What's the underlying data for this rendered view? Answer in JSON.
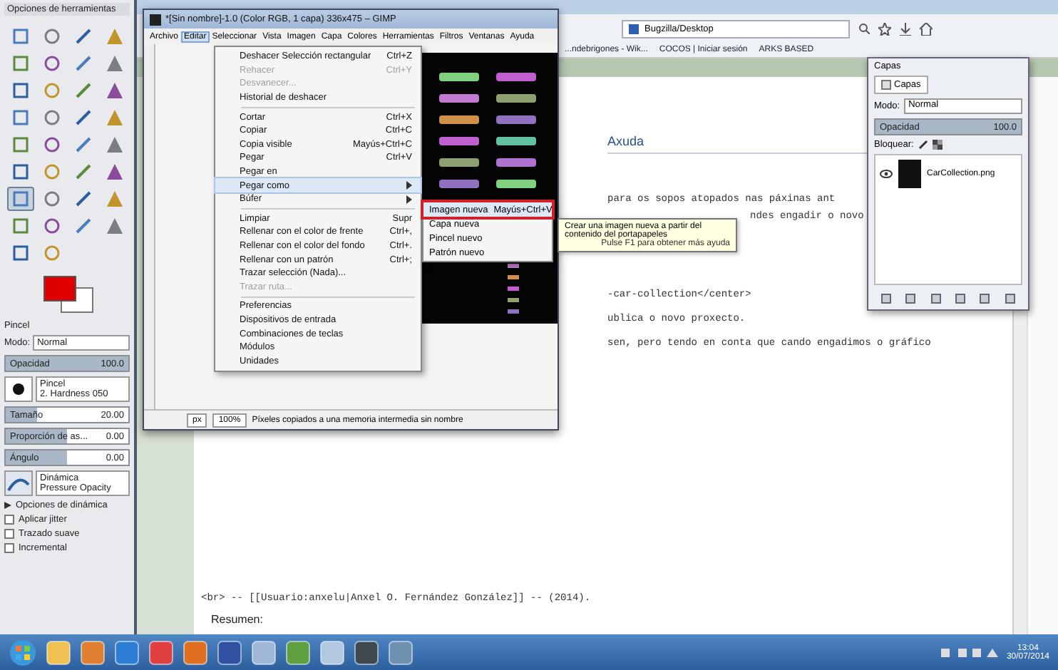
{
  "toolbox": {
    "title": "Opciones de herramientas",
    "tools": [
      {
        "selected": false
      },
      {
        "selected": false
      },
      {
        "selected": false
      },
      {
        "selected": false
      },
      {
        "selected": false
      },
      {
        "selected": false
      },
      {
        "selected": false
      },
      {
        "selected": false
      },
      {
        "selected": false
      },
      {
        "selected": false
      },
      {
        "selected": false
      },
      {
        "selected": false
      },
      {
        "selected": false
      },
      {
        "selected": false
      },
      {
        "selected": false
      },
      {
        "selected": false
      },
      {
        "selected": false
      },
      {
        "selected": false
      },
      {
        "selected": false
      },
      {
        "selected": false
      },
      {
        "selected": false
      },
      {
        "selected": false
      },
      {
        "selected": false
      },
      {
        "selected": false
      },
      {
        "selected": true
      },
      {
        "selected": false
      },
      {
        "selected": false
      },
      {
        "selected": false
      },
      {
        "selected": false
      },
      {
        "selected": false
      },
      {
        "selected": false
      },
      {
        "selected": false
      },
      {
        "selected": false
      },
      {
        "selected": false
      }
    ],
    "tool_name": "Pincel",
    "mode_label": "Modo:",
    "mode_value": "Normal",
    "sliders": [
      {
        "label": "Opacidad",
        "value": "100.0",
        "level": 1
      },
      {
        "label": "Tamaño",
        "value": "20.00",
        "level": 0.25
      },
      {
        "label": "Proporción de as...",
        "value": "0.00",
        "level": 0.5
      },
      {
        "label": "Ángulo",
        "value": "0.00",
        "level": 0.5
      }
    ],
    "brush": {
      "label": "Pincel",
      "value": "2. Hardness 050"
    },
    "dynamics": {
      "label": "Dinámica",
      "value": "Pressure Opacity"
    },
    "expander": {
      "label": "Opciones de dinámica",
      "expanded": false
    },
    "checks": [
      {
        "label": "Aplicar jitter",
        "checked": false
      },
      {
        "label": "Trazado suave",
        "checked": false
      },
      {
        "label": "Incremental",
        "checked": false
      }
    ]
  },
  "gimp": {
    "title": "*[Sin nombre]-1.0 (Color RGB, 1 capa) 336x475 – GIMP",
    "menus": [
      {
        "label": "Archivo",
        "selected": false
      },
      {
        "label": "Editar",
        "selected": true
      },
      {
        "label": "Seleccionar",
        "selected": false
      },
      {
        "label": "Vista",
        "selected": false
      },
      {
        "label": "Imagen",
        "selected": false
      },
      {
        "label": "Capa",
        "selected": false
      },
      {
        "label": "Colores",
        "selected": false
      },
      {
        "label": "Herramientas",
        "selected": false
      },
      {
        "label": "Filtros",
        "selected": false
      },
      {
        "label": "Ventanas",
        "selected": false
      },
      {
        "label": "Ayuda",
        "selected": false
      }
    ],
    "status": {
      "unit": "px",
      "zoom": "100%",
      "message": "Píxeles copiados a una memoria intermedia sin nombre"
    }
  },
  "edit_menu": [
    {
      "kind": "item",
      "label": "Deshacer Selección rectangular",
      "shortcut": "Ctrl+Z",
      "disabled": false,
      "submenu": false,
      "selected": false
    },
    {
      "kind": "item",
      "label": "Rehacer",
      "shortcut": "Ctrl+Y",
      "disabled": true,
      "submenu": false,
      "selected": false
    },
    {
      "kind": "item",
      "label": "Desvanecer...",
      "disabled": true,
      "submenu": false,
      "selected": false
    },
    {
      "kind": "item",
      "label": "Historial de deshacer",
      "disabled": false,
      "submenu": false,
      "selected": false
    },
    {
      "kind": "separator"
    },
    {
      "kind": "item",
      "label": "Cortar",
      "shortcut": "Ctrl+X",
      "disabled": false,
      "submenu": false,
      "selected": false
    },
    {
      "kind": "item",
      "label": "Copiar",
      "shortcut": "Ctrl+C",
      "disabled": false,
      "submenu": false,
      "selected": false
    },
    {
      "kind": "item",
      "label": "Copia visible",
      "shortcut": "Mayús+Ctrl+C",
      "disabled": false,
      "submenu": false,
      "selected": false
    },
    {
      "kind": "item",
      "label": "Pegar",
      "shortcut": "Ctrl+V",
      "disabled": false,
      "submenu": false,
      "selected": false
    },
    {
      "kind": "item",
      "label": "Pegar en",
      "disabled": false,
      "submenu": false,
      "selected": false
    },
    {
      "kind": "item",
      "label": "Pegar como",
      "disabled": false,
      "submenu": true,
      "selected": true
    },
    {
      "kind": "item",
      "label": "Búfer",
      "disabled": false,
      "submenu": true,
      "selected": false
    },
    {
      "kind": "separator"
    },
    {
      "kind": "item",
      "label": "Limpiar",
      "shortcut": "Supr",
      "disabled": false,
      "submenu": false,
      "selected": false
    },
    {
      "kind": "item",
      "label": "Rellenar con el color de frente",
      "shortcut": "Ctrl+,",
      "disabled": false,
      "submenu": false,
      "selected": false
    },
    {
      "kind": "item",
      "label": "Rellenar con el color del fondo",
      "shortcut": "Ctrl+.",
      "disabled": false,
      "submenu": false,
      "selected": false
    },
    {
      "kind": "item",
      "label": "Rellenar con un patrón",
      "shortcut": "Ctrl+;",
      "disabled": false,
      "submenu": false,
      "selected": false
    },
    {
      "kind": "item",
      "label": "Trazar selección (Nada)...",
      "disabled": false,
      "submenu": false,
      "selected": false
    },
    {
      "kind": "item",
      "label": "Trazar ruta...",
      "disabled": true,
      "submenu": false,
      "selected": false
    },
    {
      "kind": "separator"
    },
    {
      "kind": "item",
      "label": "Preferencias",
      "disabled": false,
      "submenu": false,
      "selected": false
    },
    {
      "kind": "item",
      "label": "Dispositivos de entrada",
      "disabled": false,
      "submenu": false,
      "selected": false
    },
    {
      "kind": "item",
      "label": "Combinaciones de teclas",
      "disabled": false,
      "submenu": false,
      "selected": false
    },
    {
      "kind": "item",
      "label": "Módulos",
      "disabled": false,
      "submenu": false,
      "selected": false
    },
    {
      "kind": "item",
      "label": "Unidades",
      "disabled": false,
      "submenu": false,
      "selected": false
    }
  ],
  "paste_as_menu": [
    {
      "label": "Imagen nueva",
      "shortcut": "Mayús+Ctrl+V",
      "selected": true
    },
    {
      "label": "Capa nueva",
      "selected": false
    },
    {
      "label": "Pincel nuevo",
      "selected": false
    },
    {
      "label": "Patrón nuevo",
      "selected": false
    }
  ],
  "tooltip": {
    "text": "Crear una imagen nueva a partir del contenido del portapapeles",
    "hint": "Pulse F1 para obtener más ayuda"
  },
  "browser": {
    "address": "Bugzilla/Desktop",
    "bookmarks": [
      "...ndebrigones - Wik...",
      "COCOS | Iniciar sesión",
      "ARKS BASED"
    ],
    "heading": "Axuda",
    "upper_lines": [
      "para os sopos atopados nas páxinas ant",
      "ndes engadir o novo",
      "-car-collection</center>",
      "ublica o novo proxecto.",
      "sen, pero tendo en conta que cando engadimos o gráfico"
    ],
    "signature": "<br> -- [[Usuario:anxelu|Anxel O. Fernández González]] -- (2014).",
    "summary_label": "Resumen:"
  },
  "layers": {
    "title": "Capas",
    "tab": "Capas",
    "mode_label": "Modo:",
    "mode_value": "Normal",
    "opacity": {
      "label": "Opacidad",
      "value": "100.0",
      "level": 1
    },
    "lock_label": "Bloquear:",
    "items": [
      {
        "name": "CarCollection.png",
        "visible": true,
        "selected": false
      }
    ]
  },
  "taskbar": {
    "time": "13:04",
    "date": "30/07/2014"
  }
}
